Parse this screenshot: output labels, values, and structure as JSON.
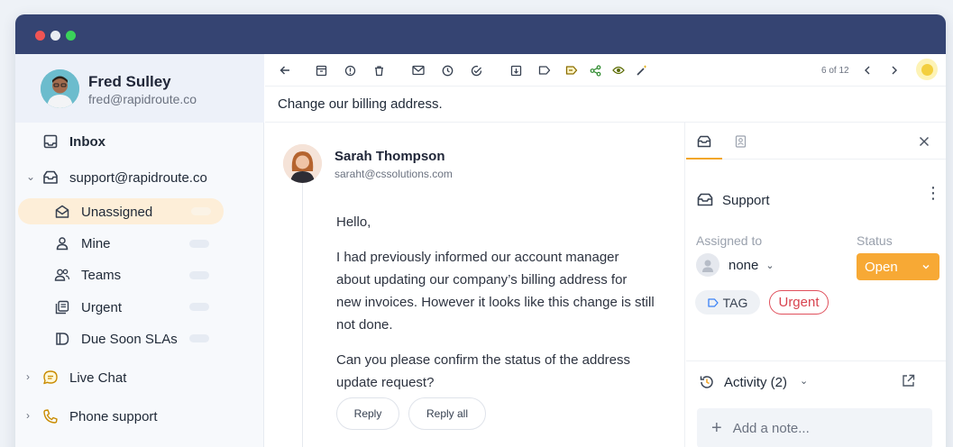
{
  "window": {
    "traffic_lights": [
      "close",
      "minimize",
      "maximize"
    ],
    "titlebar_color": "#354472"
  },
  "profile": {
    "name": "Fred Sulley",
    "email": "fred@rapidroute.co"
  },
  "sidebar": {
    "inbox_label": "Inbox",
    "support_label": "support@rapidroute.co",
    "items": [
      {
        "label": "Unassigned",
        "icon": "envelope-open-icon",
        "active": true
      },
      {
        "label": "Mine",
        "icon": "user-icon"
      },
      {
        "label": "Teams",
        "icon": "users-icon"
      },
      {
        "label": "Urgent",
        "icon": "stack-icon"
      },
      {
        "label": "Due Soon SLAs",
        "icon": "sla-icon"
      }
    ],
    "live_chat_label": "Live Chat",
    "phone_support_label": "Phone support"
  },
  "toolbar": {
    "pager": "6 of 12"
  },
  "conversation": {
    "subject": "Change our billing address.",
    "sender_name": "Sarah Thompson",
    "sender_email": "saraht@cssolutions.com",
    "greeting": "Hello,",
    "paragraph1_lines": [
      "I had previously informed our account manager",
      "about updating our company’s billing address for",
      "new invoices. However it looks like this change is still",
      "not done."
    ],
    "paragraph2_lines": [
      "Can you please confirm the status of the address",
      "update request?"
    ],
    "reply_label": "Reply",
    "reply_all_label": "Reply all"
  },
  "details": {
    "inbox_name": "Support",
    "assigned_label": "Assigned to",
    "assigned_value": "none",
    "status_label": "Status",
    "status_value": "Open",
    "tag_label": "TAG",
    "urgent_label": "Urgent",
    "activity_label": "Activity (2)",
    "note_placeholder": "Add a note...",
    "accent_color": "#f7a935",
    "urgent_color": "#d8434f"
  }
}
